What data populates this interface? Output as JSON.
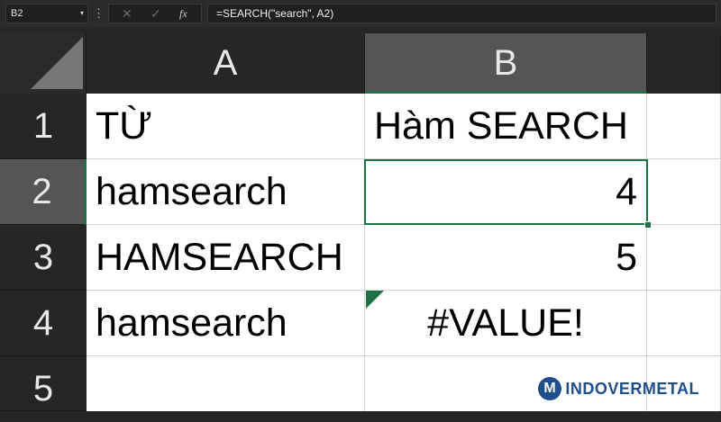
{
  "formula_bar": {
    "name_box": "B2",
    "name_box_arrow": "▾",
    "menu_dots": "⋮",
    "cancel_icon": "✕",
    "enter_icon": "✓",
    "fx_label": "fx",
    "formula": "=SEARCH(\"search\", A2)"
  },
  "grid": {
    "columns": [
      "A",
      "B"
    ],
    "rows": [
      "1",
      "2",
      "3",
      "4",
      "5"
    ],
    "cells": {
      "A1": "TỪ",
      "B1": "Hàm SEARCH",
      "A2": "hamsearch",
      "B2": "4",
      "A3": "HAMSEARCH",
      "B3": "5",
      "A4": "hamsearch",
      "B4": "#VALUE!"
    },
    "active_cell": "B2",
    "colors": {
      "selection": "#1e7145",
      "header_bg": "#262626",
      "header_active_bg": "#555555",
      "cell_bg": "#ffffff"
    }
  },
  "watermark": {
    "logo_letter": "M",
    "text": "INDOVERMETAL",
    "color": "#1f4e8c"
  }
}
